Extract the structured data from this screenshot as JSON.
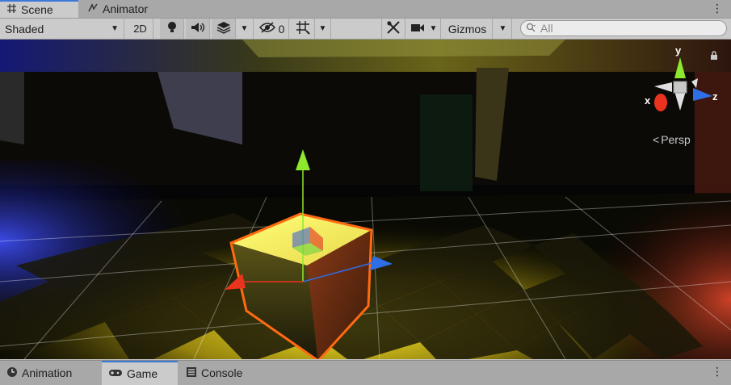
{
  "tabs": [
    {
      "label": "Scene",
      "icon": "grid-icon",
      "active": true
    },
    {
      "label": "Animator",
      "icon": "animator-icon",
      "active": false
    }
  ],
  "toolbar": {
    "draw_mode": "Shaded",
    "mode_2d": "2D",
    "hidden_count": "0",
    "gizmos": "Gizmos",
    "search_placeholder": "All"
  },
  "scene": {
    "projection": "Persp",
    "axes": {
      "x": "x",
      "y": "y",
      "z": "z"
    }
  },
  "bottom_tabs": [
    {
      "label": "Animation",
      "icon": "clock-icon",
      "active": false
    },
    {
      "label": "Game",
      "icon": "gamepad-icon",
      "active": true
    },
    {
      "label": "Console",
      "icon": "console-icon",
      "active": false
    }
  ],
  "colors": {
    "selection_outline": "#ff6a10",
    "axis_x": "#e8331e",
    "axis_y": "#8ee82e",
    "axis_z": "#2e6fe8",
    "floor_glow": "#fff200",
    "blue_light": "#3040ff"
  }
}
